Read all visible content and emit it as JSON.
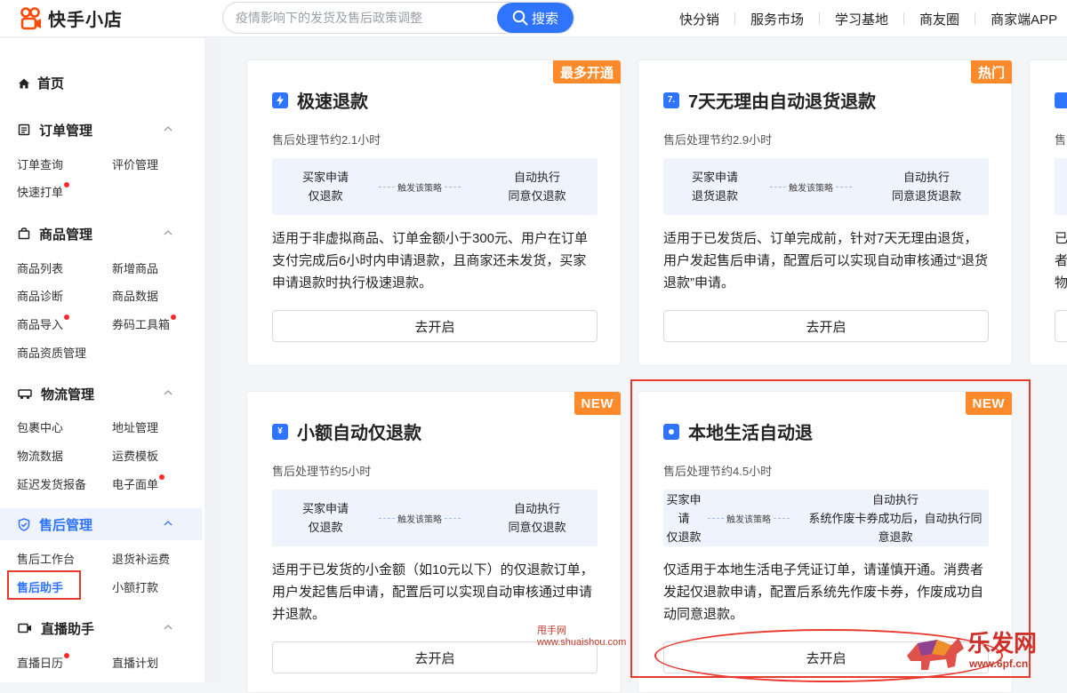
{
  "header": {
    "logo_text": "快手小店",
    "search_placeholder": "疫情影响下的发货及售后政策调整",
    "search_button": "搜索",
    "nav": [
      "快分销",
      "服务市场",
      "学习基地",
      "商友圈",
      "商家端APP"
    ]
  },
  "sidebar": {
    "home": "首页",
    "groups": [
      {
        "title": "订单管理",
        "items": [
          "订单查询",
          "评价管理",
          "快速打单"
        ]
      },
      {
        "title": "商品管理",
        "items": [
          "商品列表",
          "新增商品",
          "商品诊断",
          "商品数据",
          "商品导入",
          "券码工具箱",
          "商品资质管理"
        ]
      },
      {
        "title": "物流管理",
        "items": [
          "包裹中心",
          "地址管理",
          "物流数据",
          "运费模板",
          "延迟发货报备",
          "电子面单"
        ]
      },
      {
        "title": "售后管理",
        "items": [
          "售后工作台",
          "退货补运费",
          "售后助手",
          "小额打款"
        ]
      },
      {
        "title": "直播助手",
        "items": [
          "直播日历",
          "直播计划"
        ]
      }
    ]
  },
  "cards": [
    {
      "badge": "最多开通",
      "title": "极速退款",
      "icon": "lightning-icon",
      "sub": "售后处理节约2.1小时",
      "flow_left": [
        "买家申请",
        "仅退款"
      ],
      "flow_mid": "触发该策略",
      "flow_right": [
        "自动执行",
        "同意仅退款"
      ],
      "desc": "适用于非虚拟商品、订单金额小于300元、用户在订单支付完成后6小时内申请退款，且商家还未发货，买家申请退款时执行极速退款。",
      "button": "去开启"
    },
    {
      "badge": "热门",
      "title": "7天无理由自动退货退款",
      "icon": "seven-icon",
      "sub": "售后处理节约2.9小时",
      "flow_left": [
        "买家申请",
        "退货退款"
      ],
      "flow_mid": "触发该策略",
      "flow_right": [
        "自动执行",
        "同意退货退款"
      ],
      "desc": "适用于已发货后、订单完成前，针对7天无理由退货，用户发起售后申请，配置后可以实现自动审核通过“退货退款”申请。",
      "button": "去开启"
    },
    {
      "badge": "NEW",
      "title": "小额自动仅退款",
      "icon": "yen-icon",
      "sub": "售后处理节约5小时",
      "flow_left": [
        "买家申请",
        "仅退款"
      ],
      "flow_mid": "触发该策略",
      "flow_right": [
        "自动执行",
        "同意仅退款"
      ],
      "desc": "适用于已发货的小金额（如10元以下）的仅退款订单，用户发起售后申请，配置后可以实现自动审核通过申请并退款。",
      "button": "去开启"
    },
    {
      "badge": "NEW",
      "title": "本地生活自动退",
      "icon": "local-life-icon",
      "sub": "售后处理节约4.5小时",
      "flow_left": [
        "买家申",
        "请",
        "仅退款"
      ],
      "flow_mid": "触发该策略",
      "flow_right": [
        "自动执行",
        "系统作废卡券成功后，自动执行同",
        "意退款"
      ],
      "desc": "仅适用于本地生活电子凭证订单，请谨慎开通。消费者发起仅退款申请，配置后系统先作废卡券，作废成功自动同意退款。",
      "button": "去开启"
    }
  ],
  "partial_card": {
    "sub": "售",
    "desc_lines": [
      "已",
      "者",
      "物"
    ]
  },
  "watermarks": {
    "a_top": "甩手网",
    "a_bottom": "www.shuaishou.com",
    "b_top": "乐发网",
    "b_bottom": "www.6pf.cn"
  }
}
